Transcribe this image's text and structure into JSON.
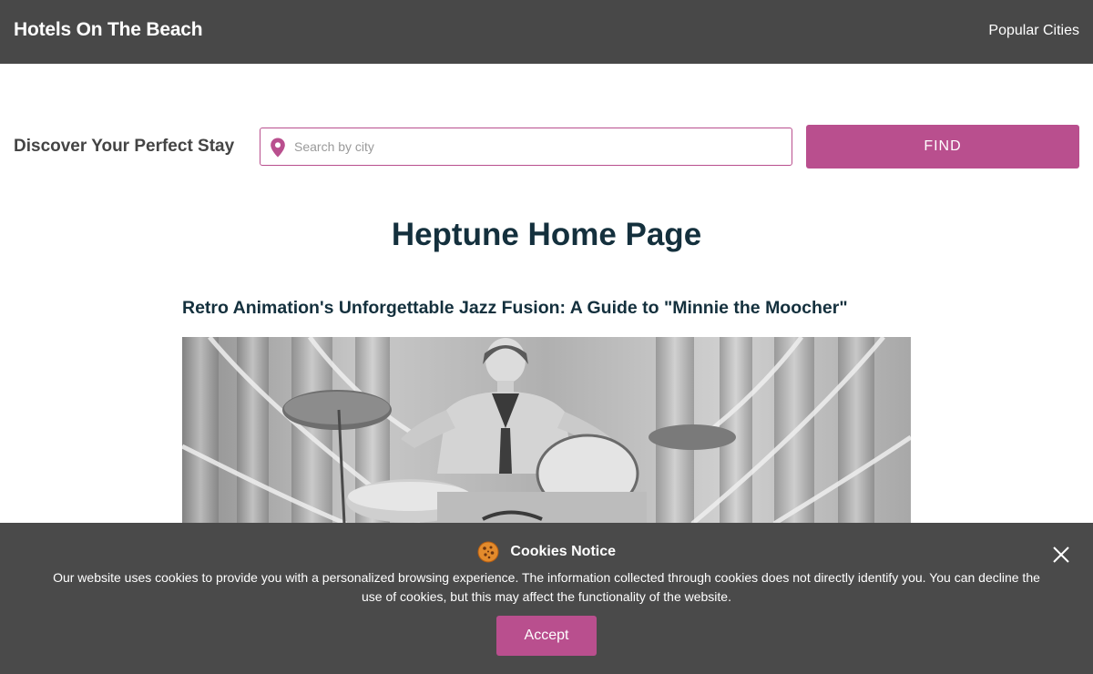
{
  "header": {
    "brand": "Hotels On The Beach",
    "nav_link": "Popular Cities"
  },
  "search": {
    "label": "Discover Your Perfect Stay",
    "placeholder": "Search by city",
    "icon": "map-pin-icon",
    "button_label": "FIND"
  },
  "main": {
    "page_title": "Heptune Home Page",
    "article_title": "Retro Animation's Unforgettable Jazz Fusion: A Guide to \"Minnie the Moocher\""
  },
  "cookie_notice": {
    "icon": "cookie-icon",
    "title": "Cookies Notice",
    "text": "Our website uses cookies to provide you with a personalized browsing experience. The information collected through cookies does not directly identify you. You can decline the use of cookies, but this may affect the functionality of the website.",
    "accept_label": "Accept",
    "close_icon": "close-icon"
  },
  "colors": {
    "header_bg": "#484848",
    "accent": "#b94f8e",
    "title_text": "#14303d",
    "banner_bg": "#4a4a4a"
  }
}
